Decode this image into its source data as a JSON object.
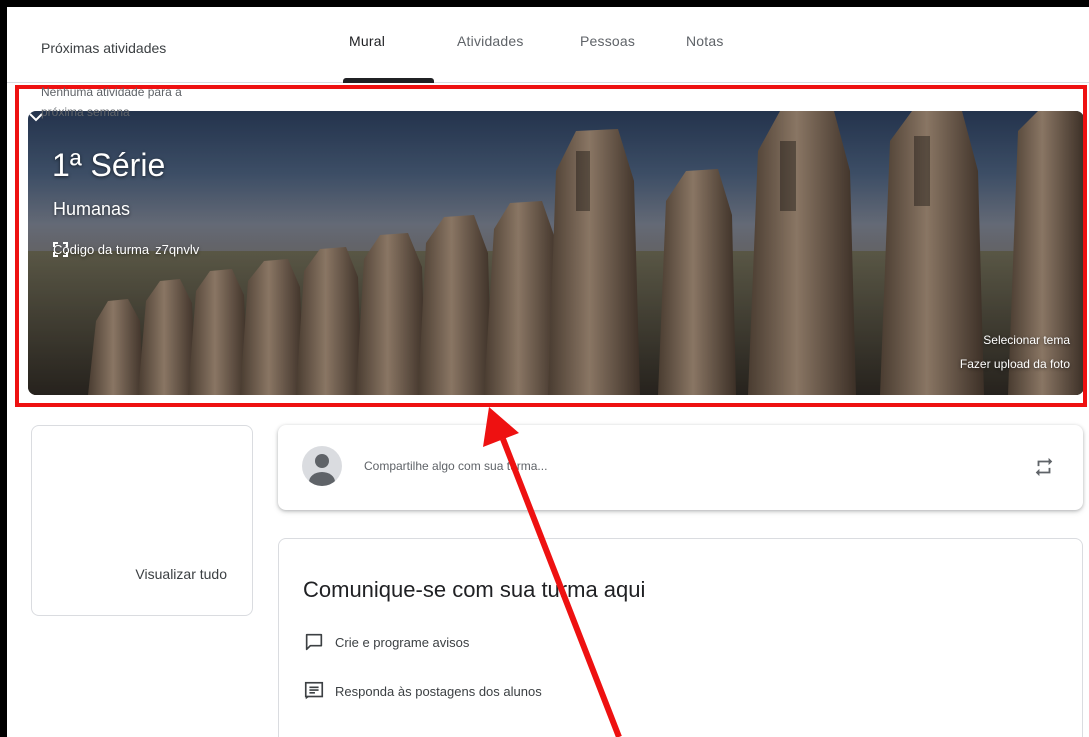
{
  "tabs": [
    {
      "label": "Mural",
      "active": true
    },
    {
      "label": "Atividades",
      "active": false
    },
    {
      "label": "Pessoas",
      "active": false
    },
    {
      "label": "Notas",
      "active": false
    }
  ],
  "banner": {
    "title": "1ª Série",
    "subtitle": "Humanas",
    "class_code_label": "Código da turma",
    "class_code_value": "z7qnvlv",
    "select_theme": "Selecionar tema",
    "upload_photo": "Fazer upload da foto"
  },
  "upcoming": {
    "title": "Próximas atividades",
    "empty_text": "Nenhuma atividade para a próxima semana",
    "view_all": "Visualizar tudo"
  },
  "share": {
    "placeholder": "Compartilhe algo com sua turma..."
  },
  "communicate": {
    "title": "Comunique-se com sua turma aqui",
    "items": [
      {
        "label": "Crie e programe avisos",
        "icon": "announcement-icon"
      },
      {
        "label": "Responda às postagens dos alunos",
        "icon": "comment-icon"
      }
    ]
  },
  "colors": {
    "annotation": "#ee1111",
    "text_primary": "#202124",
    "text_secondary": "#5f6368",
    "border": "#dadce0"
  }
}
